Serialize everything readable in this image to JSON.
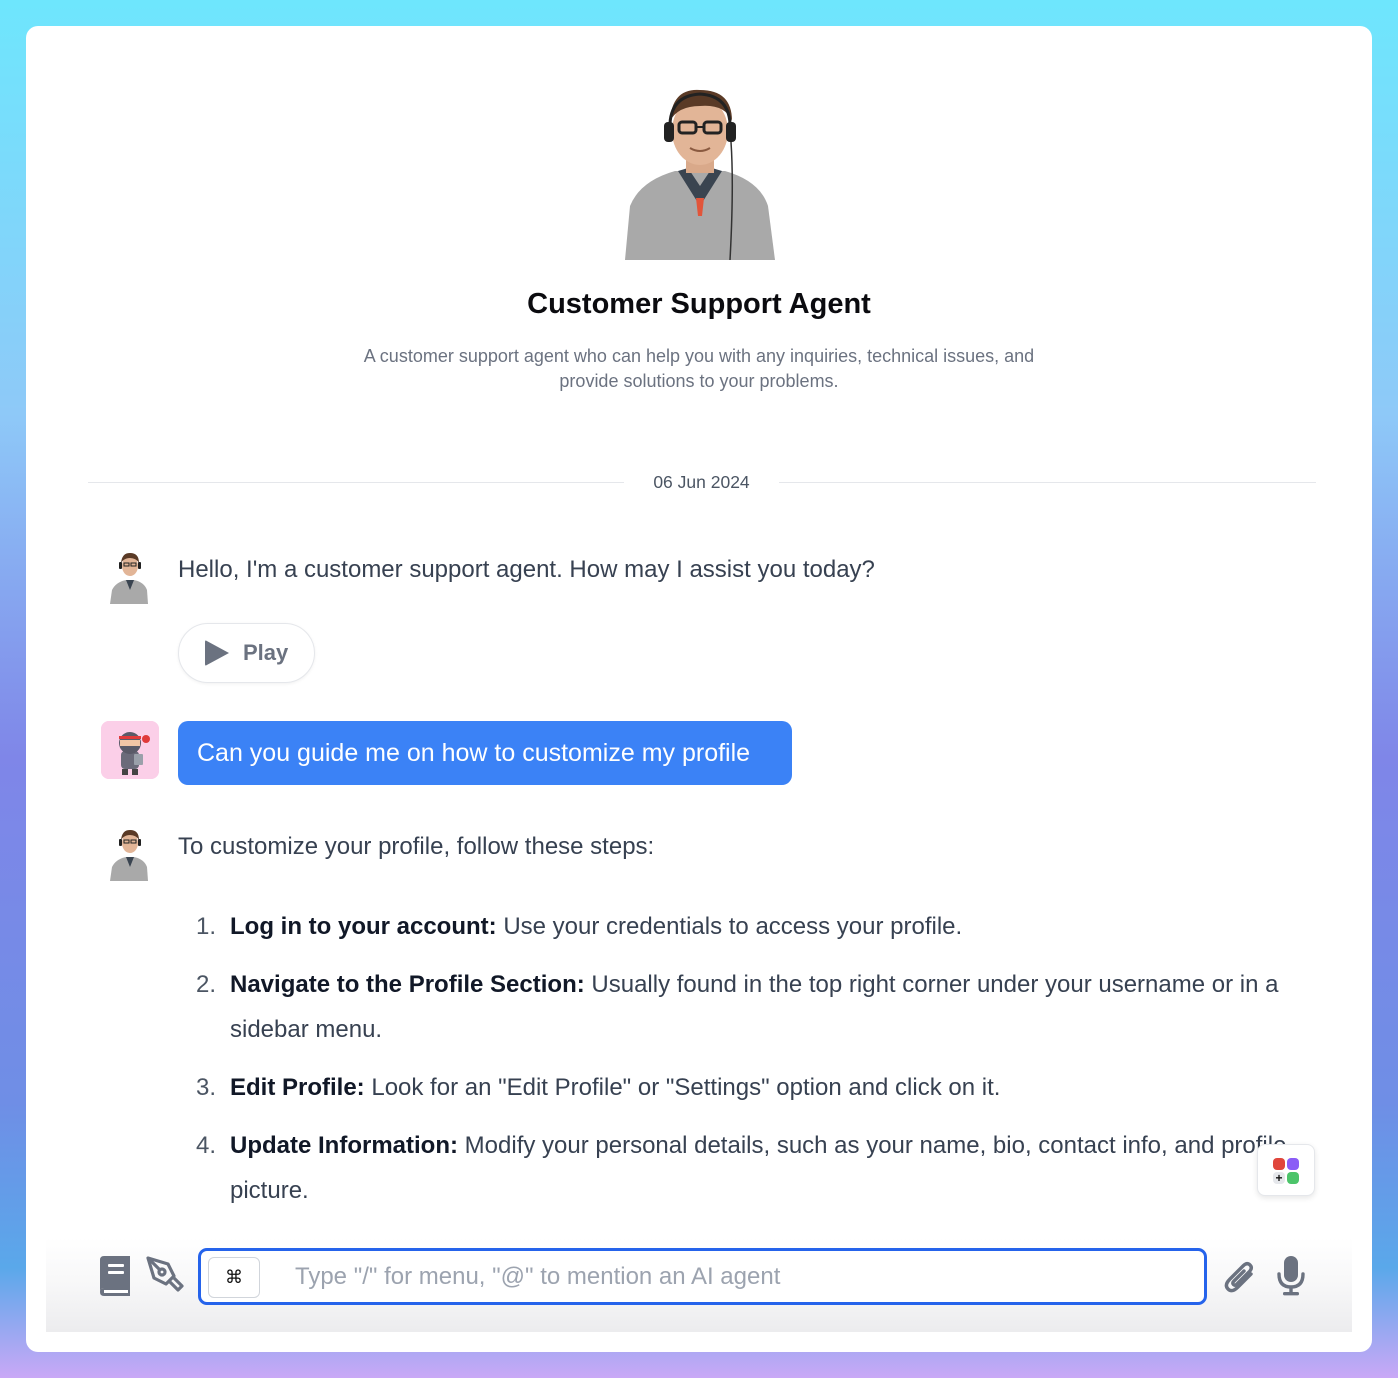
{
  "agent": {
    "name": "Customer Support Agent",
    "description": "A customer support agent who can help you with any inquiries, technical issues, and provide solutions to your problems.",
    "avatar_icon": "agent-portrait"
  },
  "chat": {
    "date_separator": "06 Jun 2024",
    "messages": [
      {
        "role": "agent",
        "text": "Hello, I'm a customer support agent. How may I assist you today?",
        "play_label": "Play"
      },
      {
        "role": "user",
        "text": "Can you guide me on how to customize my profile"
      },
      {
        "role": "agent",
        "text": "To customize your profile, follow these steps:",
        "steps": [
          {
            "num": "1.",
            "title": "Log in to your account:",
            "body": " Use your credentials to access your profile."
          },
          {
            "num": "2.",
            "title": "Navigate to the Profile Section:",
            "body": " Usually found in the top right corner under your username or in a sidebar menu."
          },
          {
            "num": "3.",
            "title": "Edit Profile:",
            "body": " Look for an \"Edit Profile\" or \"Settings\" option and click on it."
          },
          {
            "num": "4.",
            "title": "Update Information:",
            "body": " Modify your personal details, such as your name, bio, contact info, and profile picture."
          }
        ]
      }
    ]
  },
  "composer": {
    "cmd_key": "⌘",
    "placeholder": "Type \"/\" for menu, \"@\" to mention an AI agent",
    "value": "",
    "left_icons": [
      "book-icon",
      "pen-nib-icon"
    ],
    "right_icons": [
      "paperclip-icon",
      "microphone-icon"
    ]
  },
  "apps_button": {
    "icon": "apps-grid-icon",
    "colors": [
      "#e0463c",
      "#8b5cf6",
      "#e5e7eb",
      "#4cc46a"
    ]
  },
  "theme": {
    "accent": "#3b82f6",
    "input_border": "#2563eb",
    "icon_gray": "#6b7280"
  }
}
